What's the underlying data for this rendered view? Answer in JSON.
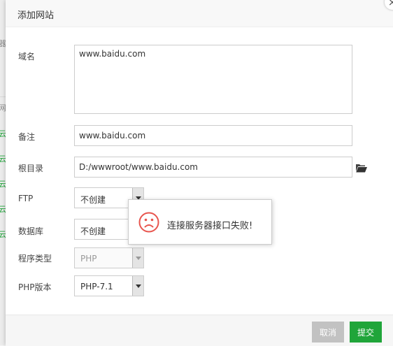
{
  "dialog": {
    "title": "添加网站",
    "close_glyph": "×"
  },
  "form": {
    "domain": {
      "label": "域名",
      "value": "www.baidu.com"
    },
    "remark": {
      "label": "备注",
      "value": "www.baidu.com"
    },
    "root_dir": {
      "label": "根目录",
      "value": "D:/wwwroot/www.baidu.com",
      "icon": "folder-open-icon"
    },
    "ftp": {
      "label": "FTP",
      "selected": "不创建"
    },
    "database": {
      "label": "数据库",
      "selected": "不创建"
    },
    "program_type": {
      "label": "程序类型",
      "selected": "PHP",
      "disabled": true
    },
    "php_version": {
      "label": "PHP版本",
      "selected": "PHP-7.1"
    }
  },
  "toast": {
    "icon": "sad-face-icon",
    "message": "连接服务器接口失败!"
  },
  "footer": {
    "cancel_label": "取消",
    "submit_label": "提交"
  },
  "colors": {
    "primary": "#20a53a",
    "error_icon": "#e8554e",
    "cancel_button": "#c2c2c2"
  },
  "background_fragments": [
    "器",
    "网",
    "云",
    "云",
    "云",
    "云",
    "云"
  ]
}
